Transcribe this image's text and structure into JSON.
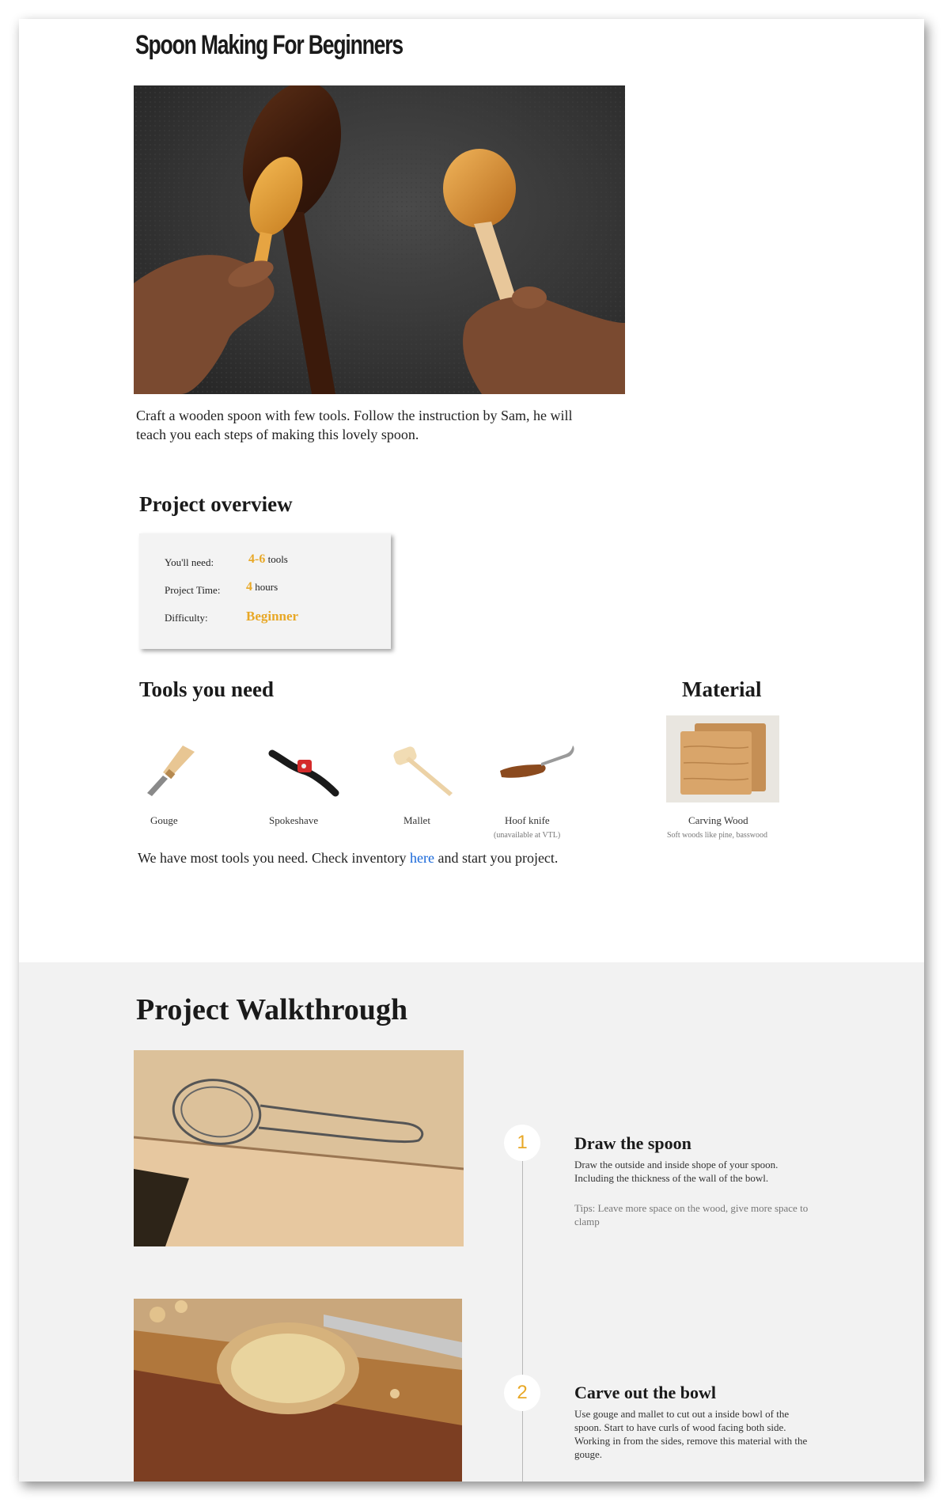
{
  "title": "Spoon Making For Beginners",
  "intro": "Craft a wooden spoon with few tools. Follow the instruction by Sam, he will teach you each steps of making this lovely spoon.",
  "overview": {
    "heading": "Project overview",
    "need_label": "You'll need:",
    "need_value": "4-6",
    "need_unit": "tools",
    "time_label": "Project Time:",
    "time_value": "4",
    "time_unit": "hours",
    "difficulty_label": "Difficulty:",
    "difficulty_value": "Beginner"
  },
  "tools": {
    "heading": "Tools you need",
    "items": [
      {
        "label": "Gouge",
        "note": ""
      },
      {
        "label": "Spokeshave",
        "note": ""
      },
      {
        "label": "Mallet",
        "note": ""
      },
      {
        "label": "Hoof knife",
        "note": "(unavailable at VTL)"
      }
    ],
    "inventory_before": "We have most tools you need. Check inventory",
    "inventory_link": "here",
    "inventory_after": "and start you project."
  },
  "material": {
    "heading": "Material",
    "label": "Carving Wood",
    "note": "Soft woods like pine, basswood"
  },
  "walkthrough": {
    "heading": "Project Walkthrough",
    "steps": [
      {
        "number": "1",
        "title": "Draw the spoon",
        "desc": "Draw the outside and inside shope of your spoon. Including the thickness of the wall of the bowl.",
        "tip": "Tips: Leave more space on the wood, give more space to clamp"
      },
      {
        "number": "2",
        "title": "Carve out the bowl",
        "desc": "Use gouge and mallet to cut out a inside bowl of the spoon. Start to have curls of wood facing both side. Working in from the sides, remove this material with the gouge.",
        "tip": ""
      }
    ]
  },
  "colors": {
    "accent": "#e8a827",
    "link": "#1565d8",
    "section_bg": "#f2f2f2"
  }
}
